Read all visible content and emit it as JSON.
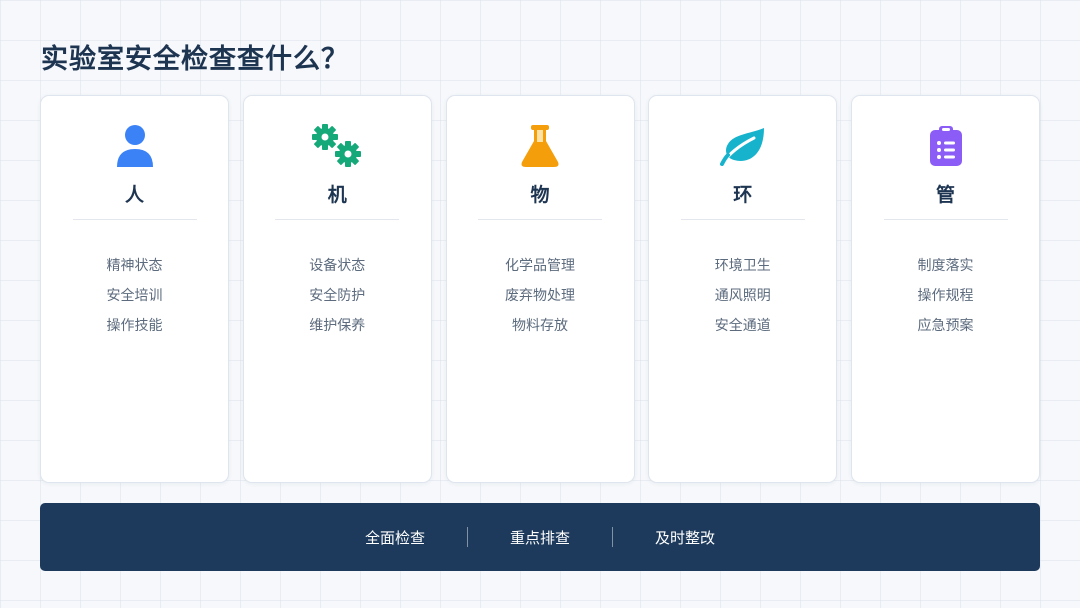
{
  "page": {
    "title": "实验室安全检查查什么？"
  },
  "cards": [
    {
      "title": "人",
      "icon": "person-icon",
      "color": "#3b82f6",
      "items": [
        "精神状态",
        "安全培训",
        "操作技能"
      ]
    },
    {
      "title": "机",
      "icon": "gears-icon",
      "color": "#15a979",
      "items": [
        "设备状态",
        "安全防护",
        "维护保养"
      ]
    },
    {
      "title": "物",
      "icon": "flask-icon",
      "color": "#f59e0b",
      "items": [
        "化学品管理",
        "废弃物处理",
        "物料存放"
      ]
    },
    {
      "title": "环",
      "icon": "leaf-icon",
      "color": "#17b3cc",
      "items": [
        "环境卫生",
        "通风照明",
        "安全通道"
      ]
    },
    {
      "title": "管",
      "icon": "clipboard-list-icon",
      "color": "#8b5cf6",
      "items": [
        "制度落实",
        "操作规程",
        "应急预案"
      ]
    }
  ],
  "footer": {
    "items": [
      "全面检查",
      "重点排查",
      "及时整改"
    ]
  }
}
